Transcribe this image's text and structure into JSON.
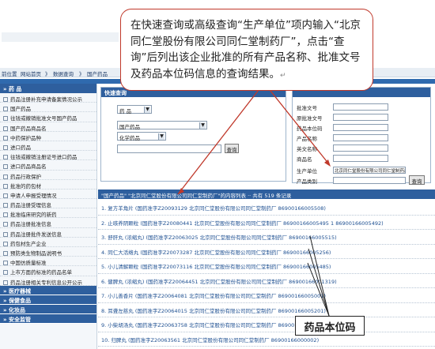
{
  "header": {
    "left_text": "前位置 网站首页 》 数据查询 》 国产药品",
    "left_text_top": "自位置 网站首页"
  },
  "nav": {
    "crumb": [
      "前位置",
      "网站首页",
      "》",
      "数据查询",
      "》",
      "国产药品"
    ]
  },
  "sidebar": {
    "head": "» 药 品",
    "items": [
      "药品注册补充申请备案情况公示",
      "国产药品",
      "往钱或撤销批准文号国产药品",
      "国产药品商品名",
      "中药保护品种",
      "进口药品",
      "往钱或撤销注册证号进口药品",
      "进口药品商品名",
      "药品行政保护",
      "批准的药包材",
      "申请人申报受理情况",
      "药品注册受理信息",
      "批准临床研究的新药",
      "药品注册批准信息",
      "药品注册批件发送信息",
      "药包材生产企业",
      "预防类生物制品说明书",
      "中国仿质量标准",
      "上市方面药标准的药品名单",
      "药品注册相关专利信息公开公示"
    ],
    "categories": [
      "» 医疗器械",
      "» 保健食品",
      "» 化妆品",
      "» 安全监管"
    ]
  },
  "quick_search": {
    "title": "快速查询",
    "select1": "药  品",
    "select2": "国产药品",
    "select3": "化学药品",
    "button": "查询"
  },
  "advanced_search": {
    "labels": [
      "批准文号",
      "原批准文号",
      "药品本位码",
      "产品名称",
      "英文名称",
      "商品名",
      "生产单位",
      "产品类别"
    ],
    "producer_value": "北京同仁堂股份有限公司同仁堂制药厂",
    "button": "查询"
  },
  "result_bar": "\"国产药品\" \"北京同仁堂股份有限公司同仁堂制药厂\"的内容列表 ·· 共有 519 条记录",
  "results": [
    "1. 复方羊角片 (国药准字Z20093129 北京同仁堂股份有限公司同仁堂制药厂 86900166005508)",
    "2. 止咳养阴颗粒 (国药准字Z20080441 北京同仁堂股份有限公司同仁堂制药厂 86900166005495 1 86900166005492)",
    "3. 舒肝丸 (浓缩丸) (国药准字Z20063025 北京同仁堂股份有限公司同仁堂制药厂 86900166005515)",
    "4. 同仁大活络丸 (国药准字Z20073287 北京同仁堂股份有限公司同仁堂制药厂 86900166005256)",
    "5. 小儿清解颗粒 (国药准字Z20073116 北京同仁堂股份有限公司同仁堂制药厂 86900166005485)",
    "6. 健脾丸 (浓缩丸) (国药准字Z20064451 北京同仁堂股份有限公司同仁堂制药厂 86900166001319)",
    "7. 小儿善香片 (国药准字Z20064081 北京同仁堂股份有限公司同仁堂制药厂 86900166005001)",
    "8. 耳聋左慈丸 (国药准字Z20064015 北京同仁堂股份有限公司同仁堂制药厂 86900166005201)",
    "9. 小柴胡汤丸 (国药准字Z20063758 北京同仁堂股份有限公司同仁堂制药厂 86900166005081)",
    "10. 归脾丸 (国药准字Z20063561 北京同仁堂股份有限公司同仁堂制药厂 86900166000002)"
  ],
  "callout": "在快速查询或高级查询“生产单位”项内输入“北京同仁堂股份有限公司同仁堂制药厂”，点击“查询”后列出该企业批准的所有产品名称、批准文号及药品本位码信息的查询结果。",
  "callout_return": "↵",
  "label_box": "药品本位码",
  "colors": {
    "nav_blue": "#2e5f9e",
    "accent_red": "#c0392b",
    "link_blue": "#1d4f91"
  }
}
